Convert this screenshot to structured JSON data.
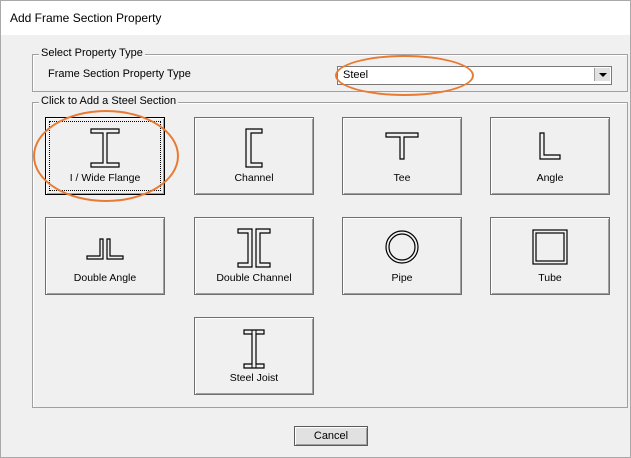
{
  "window": {
    "title": "Add Frame Section Property"
  },
  "property_type": {
    "group_label": "Select Property Type",
    "field_label": "Frame Section Property Type",
    "selected_value": "Steel"
  },
  "sections": {
    "group_label": "Click to Add a Steel Section",
    "items": [
      {
        "label": "I / Wide Flange",
        "icon": "i-beam-icon",
        "selected": true
      },
      {
        "label": "Channel",
        "icon": "channel-icon"
      },
      {
        "label": "Tee",
        "icon": "tee-icon"
      },
      {
        "label": "Angle",
        "icon": "angle-icon"
      },
      {
        "label": "Double Angle",
        "icon": "double-angle-icon"
      },
      {
        "label": "Double Channel",
        "icon": "double-channel-icon"
      },
      {
        "label": "Pipe",
        "icon": "pipe-icon"
      },
      {
        "label": "Tube",
        "icon": "tube-icon"
      },
      {
        "label": "Steel Joist",
        "icon": "steel-joist-icon"
      }
    ]
  },
  "buttons": {
    "cancel": "Cancel"
  },
  "colors": {
    "annotation": "#e97a32",
    "dialog_bg": "#f0f0f0"
  }
}
